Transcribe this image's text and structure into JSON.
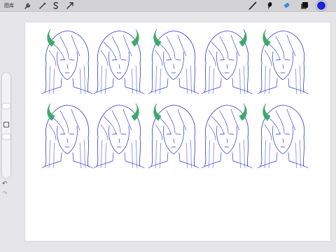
{
  "toolbar": {
    "gallery_label": "图库",
    "left_icons": [
      "wrench-icon",
      "magic-wand-icon",
      "selection-icon",
      "transform-arrow-icon"
    ],
    "right_icons": [
      "brush-icon",
      "smudge-icon",
      "eraser-icon",
      "layers-icon"
    ],
    "color": "#1a25d6"
  },
  "sidebar": {
    "undo_glyph": "↶",
    "redo_glyph": "↷"
  },
  "canvas": {
    "background": "#ffffff",
    "ink_color": "#2b3ad0",
    "accent_color": "#3fa86a",
    "sketch_rows": 2,
    "sketch_columns": 5
  }
}
